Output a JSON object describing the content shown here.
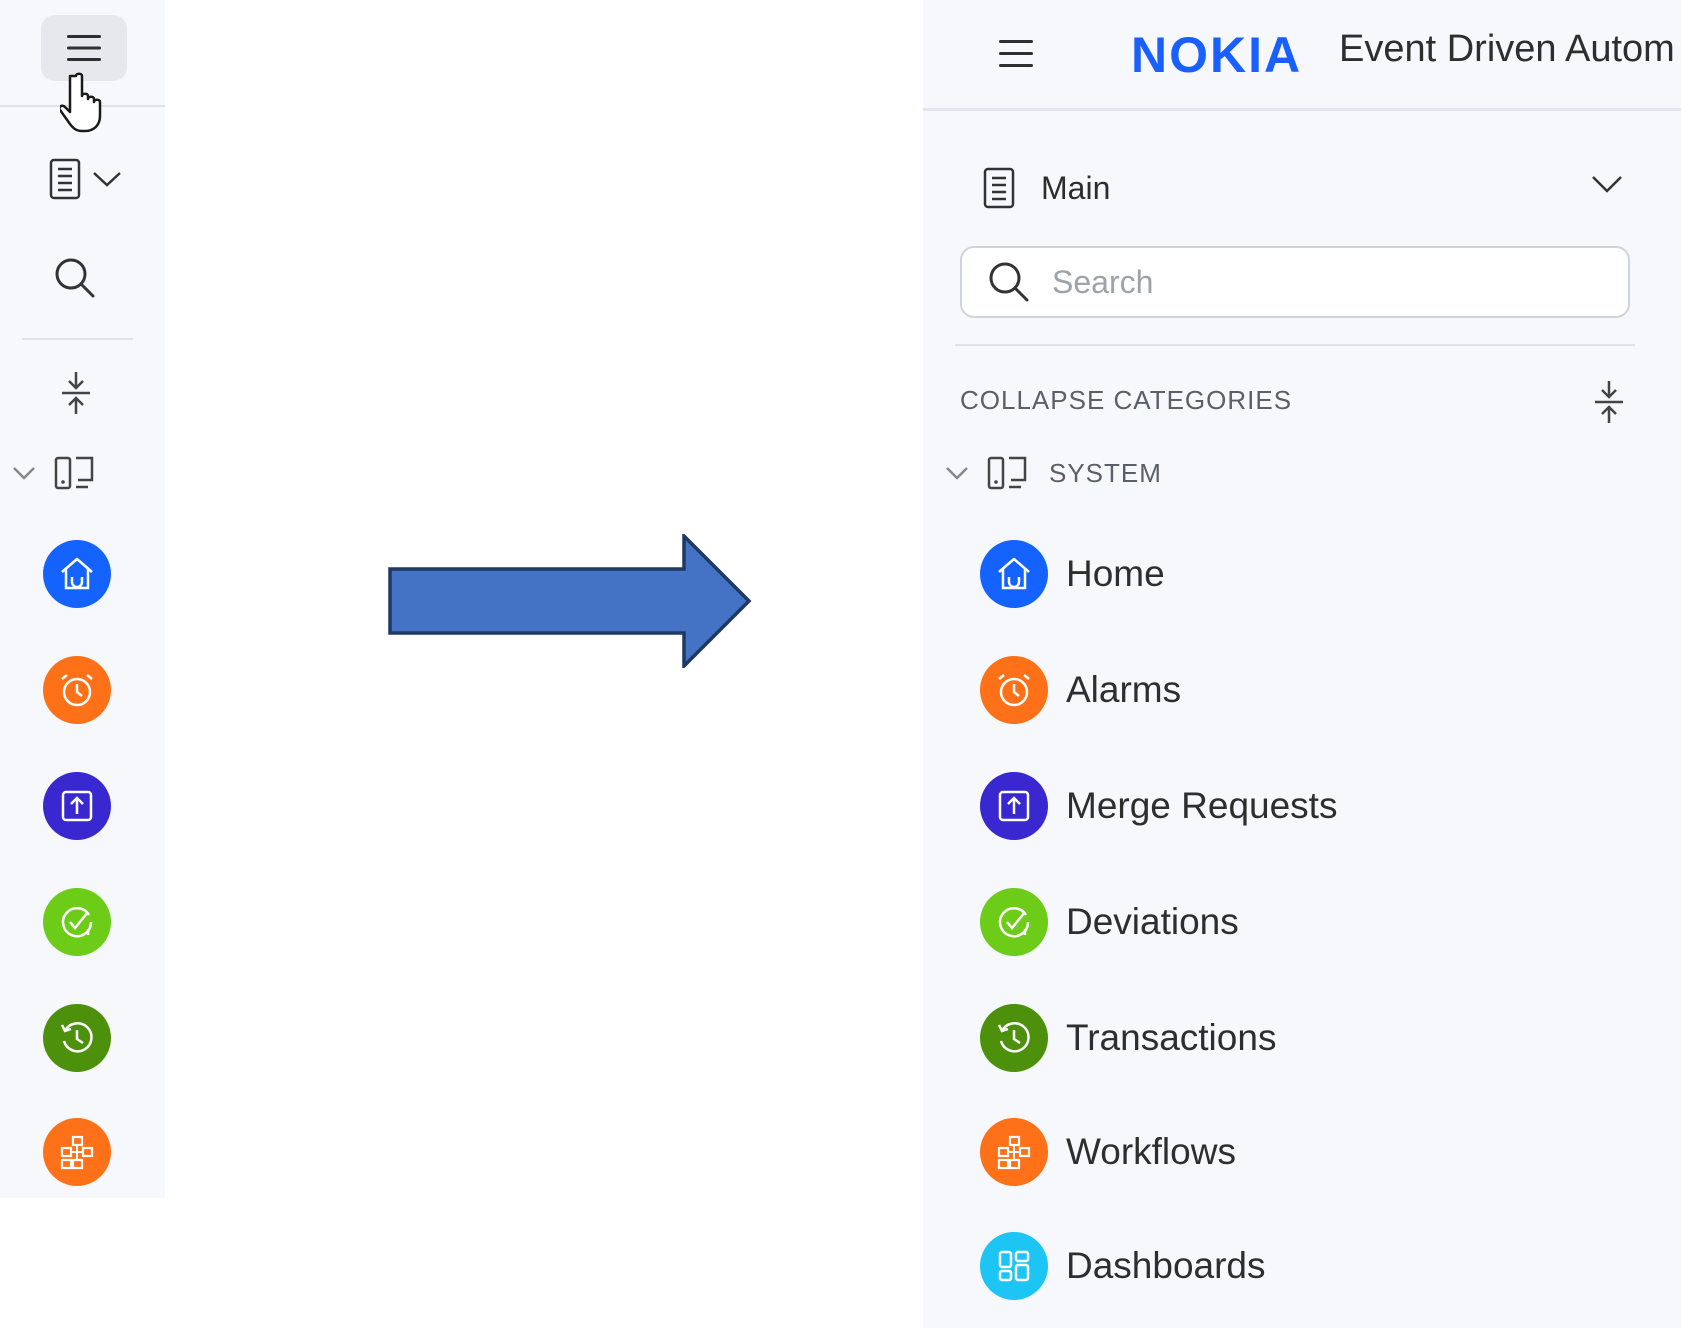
{
  "colors": {
    "home": "#1463ff",
    "alarms": "#ff7118",
    "merge": "#3928cf",
    "deviations": "#6ccc18",
    "transactions": "#4d900c",
    "workflows": "#ff7118",
    "dashboards": "#1cc5f3",
    "arrow_fill": "#4472c4",
    "arrow_stroke": "#1f3864",
    "nokia_blue": "#1a5fff"
  },
  "header": {
    "logo": "NOKIA",
    "title": "Event Driven Autom"
  },
  "navigation_selector": {
    "label": "Main"
  },
  "search": {
    "placeholder": "Search",
    "value": ""
  },
  "collapse_categories": {
    "label": "COLLAPSE CATEGORIES"
  },
  "category": {
    "label": "SYSTEM"
  },
  "nav_items": [
    {
      "label": "Home",
      "icon": "home-icon"
    },
    {
      "label": "Alarms",
      "icon": "alarm-clock-icon"
    },
    {
      "label": "Merge Requests",
      "icon": "upload-box-icon"
    },
    {
      "label": "Deviations",
      "icon": "check-circle-icon"
    },
    {
      "label": "Transactions",
      "icon": "history-icon"
    },
    {
      "label": "Workflows",
      "icon": "workflow-icon"
    },
    {
      "label": "Dashboards",
      "icon": "dashboard-grid-icon"
    }
  ]
}
